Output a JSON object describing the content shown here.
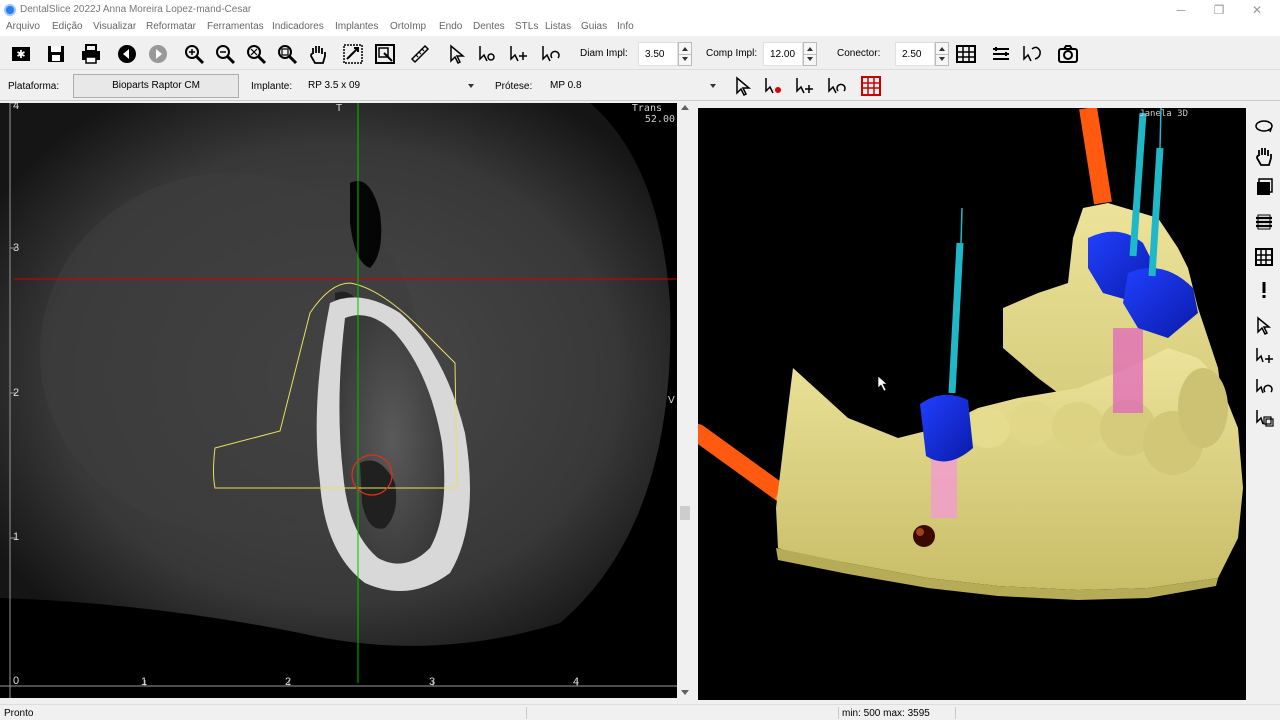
{
  "window": {
    "title": "DentalSlice 2022J Anna Moreira Lopez-mand-Cesar",
    "minimize": "─",
    "restore": "❐",
    "close": "✕"
  },
  "menu": [
    "Arquivo",
    "Edição",
    "Visualizar",
    "Reformatar",
    "Ferramentas",
    "Indicadores",
    "Implantes",
    "OrtoImp",
    "Endo",
    "Dentes",
    "STLs",
    "Listas",
    "Guias",
    "Info"
  ],
  "toolbar": {
    "diam_label": "Diam Impl:",
    "diam_value": "3.50",
    "comp_label": "Comp Impl:",
    "comp_value": "12.00",
    "conector_label": "Conector:",
    "conector_value": "2.50"
  },
  "toolbar2": {
    "plataforma_label": "Plataforma:",
    "plataforma_value": "Bioparts Raptor CM",
    "implante_label": "Implante:",
    "implante_value": "RP 3.5 x 09",
    "protese_label": "Prótese:",
    "protese_value": "MP 0.8"
  },
  "ct_view": {
    "trans_label": "Trans",
    "trans_value": "52.00",
    "top_marker": "T",
    "side_marker": "V",
    "y_ticks": [
      "4",
      "3",
      "2",
      "1",
      "0"
    ],
    "x_ticks": [
      "1",
      "2",
      "3",
      "4"
    ],
    "colors": {
      "crosshair_h": "#d00000",
      "crosshair_v": "#00c000",
      "outline": "#e8e060",
      "implant_circle": "#e03010"
    }
  },
  "view3d": {
    "title": "Janela 3D",
    "colors": {
      "model": "#e0d68a",
      "crown": "#1030e0",
      "pin": "#20b8c8",
      "nerve": "#ff5a10"
    }
  },
  "status": {
    "left": "Pronto",
    "minmax": "min: 500  max: 3595"
  },
  "icons": [
    "new-icon",
    "save-icon",
    "print-icon",
    "back-icon",
    "forward-icon",
    "zoom-in-icon",
    "zoom-out-icon",
    "zoom-fit-icon",
    "zoom-window-icon",
    "hand-icon",
    "reformat-icon",
    "window-icon",
    "ruler-icon",
    "select-arrow-icon",
    "camera-icon",
    "grid-icon",
    "rotate-icon",
    "layers-icon",
    "exclamation-icon"
  ]
}
